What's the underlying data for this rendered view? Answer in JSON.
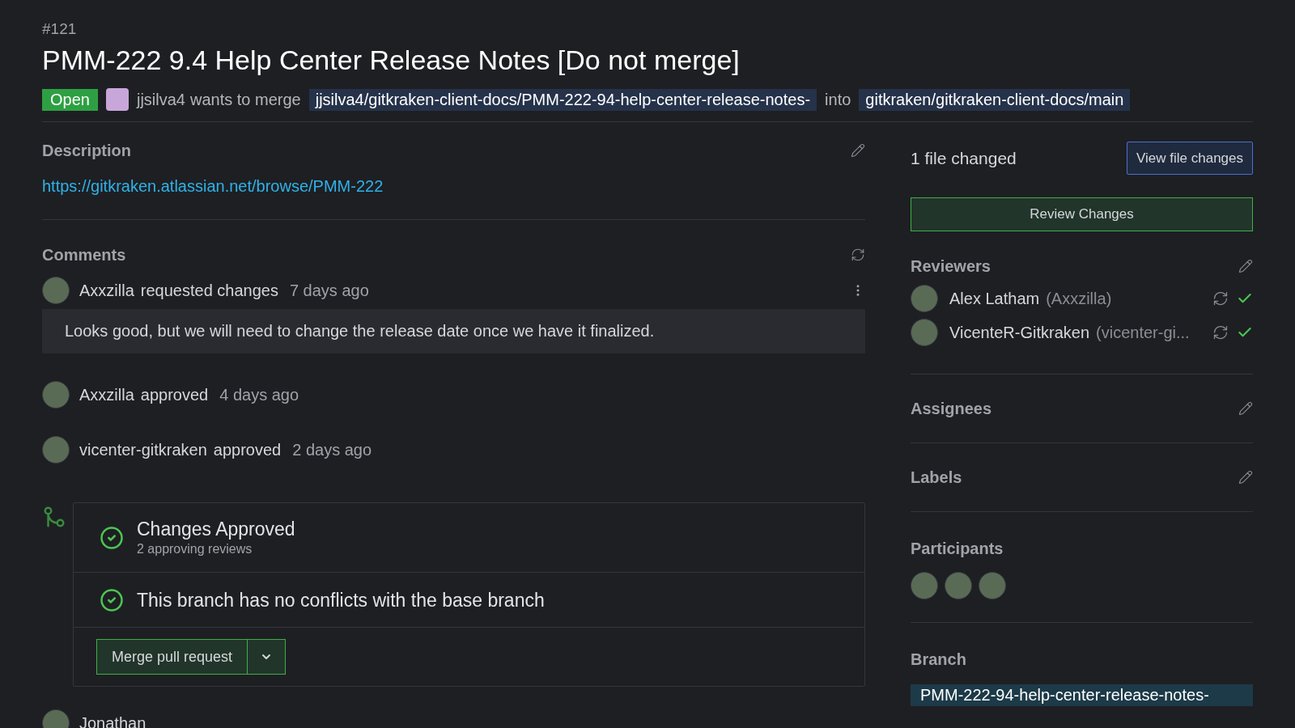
{
  "number": "#121",
  "title": "PMM-222 9.4 Help Center Release Notes [Do not merge]",
  "header": {
    "status": "Open",
    "author": "jjsilva4",
    "action": "wants to merge",
    "source_branch": "jjsilva4/gitkraken-client-docs/PMM-222-94-help-center-release-notes-",
    "into": "into",
    "target_branch": "gitkraken/gitkraken-client-docs/main"
  },
  "description": {
    "heading": "Description",
    "link": "https://gitkraken.atlassian.net/browse/PMM-222"
  },
  "comments": {
    "heading": "Comments",
    "events": [
      {
        "author": "Axxzilla",
        "action": "requested changes",
        "time": "7 days ago",
        "body": "Looks good, but we will need to change the release date once we have it finalized."
      },
      {
        "author": "Axxzilla",
        "action": "approved",
        "time": "4 days ago"
      },
      {
        "author": "vicenter-gitkraken",
        "action": "approved",
        "time": "2 days ago"
      }
    ]
  },
  "merge_box": {
    "checks": [
      {
        "title": "Changes Approved",
        "subtitle": "2 approving reviews"
      },
      {
        "title": "This branch has no conflicts with the base branch"
      }
    ],
    "merge_button": "Merge pull request"
  },
  "next_comment_author": "Jonathan",
  "sidebar": {
    "files_changed": "1 file changed",
    "view_button": "View file changes",
    "review_button": "Review Changes",
    "reviewers": {
      "heading": "Reviewers",
      "items": [
        {
          "name": "Alex Latham",
          "handle": "(Axxzilla)",
          "approved": true
        },
        {
          "name": "VicenteR-Gitkraken",
          "handle": "(vicenter-gi...",
          "approved": true
        }
      ]
    },
    "assignees": {
      "heading": "Assignees"
    },
    "labels": {
      "heading": "Labels"
    },
    "participants": {
      "heading": "Participants",
      "avatars": [
        {
          "kind": "photo"
        },
        {
          "kind": "photo"
        },
        {
          "kind": "photo"
        }
      ]
    },
    "branch": {
      "heading": "Branch",
      "name": "PMM-222-94-help-center-release-notes-"
    }
  }
}
